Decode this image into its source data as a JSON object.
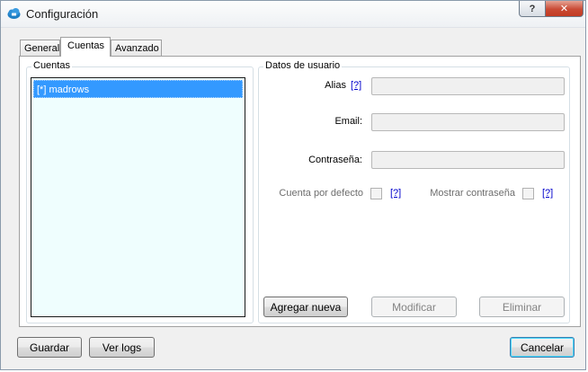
{
  "window": {
    "title": "Configuración",
    "help_glyph": "?",
    "close_glyph": "✕",
    "accent": "#3399ff"
  },
  "tabs": [
    {
      "label": "General",
      "selected": false
    },
    {
      "label": "Cuentas",
      "selected": true
    },
    {
      "label": "Avanzado",
      "selected": false
    }
  ],
  "accounts": {
    "group_label": "Cuentas",
    "items": [
      {
        "label": "[*] madrows",
        "selected": true
      }
    ]
  },
  "user_data": {
    "group_label": "Datos de usuario",
    "alias_label": "Alias",
    "alias_value": "",
    "email_label": "Email:",
    "email_value": "",
    "password_label": "Contraseña:",
    "password_value": "",
    "default_account_label": "Cuenta por defecto",
    "default_account_checked": false,
    "show_password_label": "Mostrar contraseña",
    "show_password_checked": false,
    "help_text": "[?]",
    "add_new_label": "Agregar nueva",
    "modify_label": "Modificar",
    "delete_label": "Eliminar"
  },
  "footer": {
    "save_label": "Guardar",
    "view_logs_label": "Ver logs",
    "cancel_label": "Cancelar"
  },
  "icons": {
    "app": "cloud-icon",
    "help": "help-icon",
    "close": "close-icon"
  }
}
